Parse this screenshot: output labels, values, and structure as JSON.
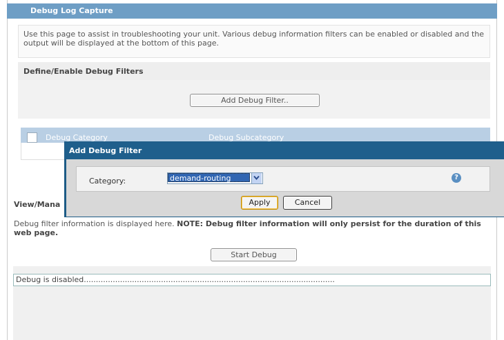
{
  "page": {
    "title": "Debug Log Capture",
    "description": "Use this page to assist in troubleshooting your unit. Various debug information filters can be enabled or disabled and the output will be displayed at the bottom of this page."
  },
  "filters": {
    "heading": "Define/Enable Debug Filters",
    "add_button": "Add Debug Filter..",
    "table": {
      "col_category": "Debug Category",
      "col_subcategory": "Debug Subcategory"
    }
  },
  "view": {
    "heading": "View/Mana",
    "note_prefix": "Debug filter information is displayed here. ",
    "note_bold": "NOTE: Debug filter information will only persist for the duration of this web page.",
    "start_button": "Start Debug",
    "log_text": "Debug is disabled........................................................................................................"
  },
  "modal": {
    "title": "Add Debug Filter",
    "category_label": "Category:",
    "category_value": "demand-routing",
    "help_icon": "question-icon",
    "apply": "Apply",
    "cancel": "Cancel"
  },
  "colors": {
    "title_bar": "#6e9ec5",
    "modal_title": "#1f5f8c",
    "selection": "#3166b2"
  }
}
